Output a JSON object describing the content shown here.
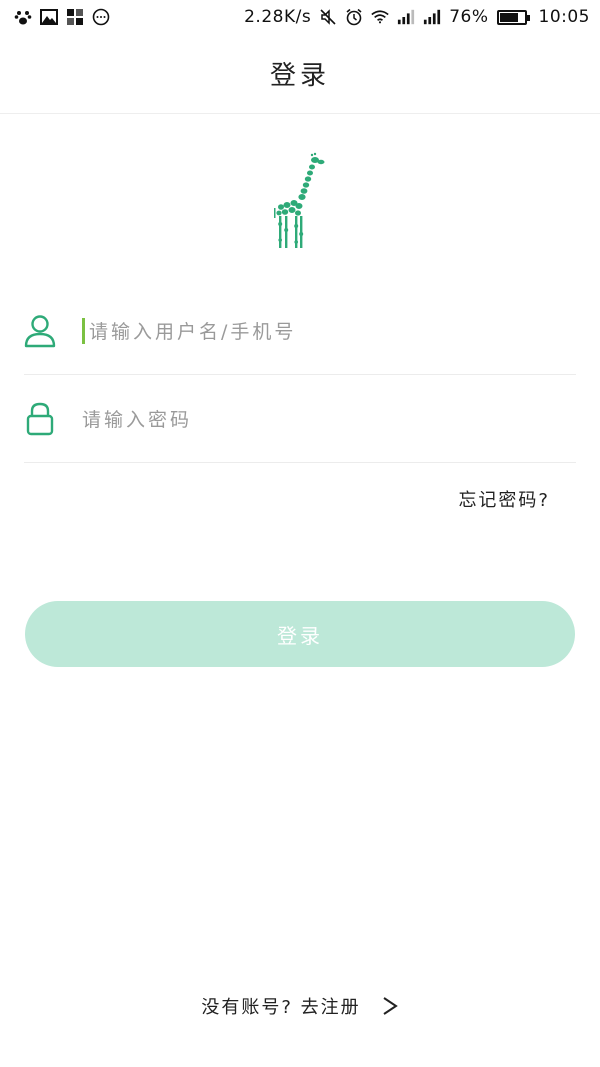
{
  "status_bar": {
    "icons_left": [
      "paw-icon",
      "image-icon",
      "grid-icon",
      "chat-icon"
    ],
    "net_speed": "2.28K/s",
    "battery_percent_text": "76%",
    "battery_level": 0.76,
    "time": "10:05"
  },
  "header": {
    "title": "登录"
  },
  "form": {
    "username_placeholder": "请输入用户名/手机号",
    "password_placeholder": "请输入密码",
    "forgot_label": "忘记密码?",
    "login_label": "登录"
  },
  "footer": {
    "register_label": "没有账号? 去注册"
  },
  "colors": {
    "accent": "#2eaa78",
    "button_bg": "#bde8d8",
    "caret": "#7bc142"
  }
}
